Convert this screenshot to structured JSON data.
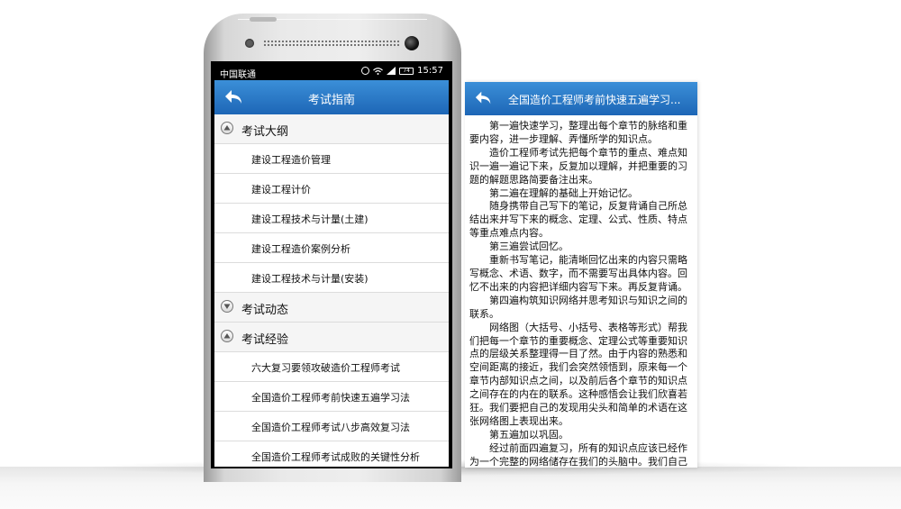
{
  "phone": {
    "status": {
      "carrier": "中国联通",
      "battery": "74",
      "time": "15:57"
    },
    "title": "考试指南",
    "list": [
      {
        "type": "category",
        "label": "考试大纲",
        "expanded": true
      },
      {
        "type": "item",
        "label": "建设工程造价管理"
      },
      {
        "type": "item",
        "label": "建设工程计价"
      },
      {
        "type": "item",
        "label": "建设工程技术与计量(土建)"
      },
      {
        "type": "item",
        "label": "建设工程造价案例分析"
      },
      {
        "type": "item",
        "label": "建设工程技术与计量(安装)"
      },
      {
        "type": "category",
        "label": "考试动态",
        "expanded": false
      },
      {
        "type": "category",
        "label": "考试经验",
        "expanded": true
      },
      {
        "type": "item",
        "label": "六大复习要领攻破造价工程师考试"
      },
      {
        "type": "item",
        "label": "全国造价工程师考前快速五遍学习法"
      },
      {
        "type": "item",
        "label": "全国造价工程师考试八步高效复习法"
      },
      {
        "type": "item",
        "label": "全国造价工程师考试成败的关键性分析"
      }
    ]
  },
  "article": {
    "title": "全国造价工程师考前快速五遍学习...",
    "paragraphs": [
      "第一遍快速学习，整理出每个章节的脉络和重要内容，进一步理解、弄懂所学的知识点。",
      "造价工程师考试先把每个章节的重点、难点知识一遍一遍记下来，反复加以理解，并把重要的习题的解题思路简要备注出来。",
      "第二遍在理解的基础上开始记忆。",
      "随身携带自己写下的笔记，反复背诵自己所总结出来并写下来的概念、定理、公式、性质、特点等重点难点内容。",
      "第三遍尝试回忆。",
      "重新书写笔记，能清晰回忆出来的内容只需略写概念、术语、数字，而不需要写出具体内容。回忆不出来的内容把详细内容写下来。再反复背诵。",
      "第四遍构筑知识网络并思考知识与知识之间的联系。",
      "网络图（大括号、小括号、表格等形式）帮我们把每一个章节的重要概念、定理公式等重要知识点的层级关系整理得一目了然。由于内容的熟悉和空间距离的接近，我们会突然领悟到，原来每一个章节内部知识点之间，以及前后各个章节的知识点之间存在的内在的联系。这种感悟会让我们欣喜若狂。我们要把自己的发现用尖头和简单的术语在这张网络图上表现出来。",
      "第五遍加以巩固。",
      "经过前面四遍复习，所有的知识点应该已经作为一个完整的网络储存在我们的头脑中。我们自己总结出来的最后一张网络图就能把所学的知"
    ]
  }
}
